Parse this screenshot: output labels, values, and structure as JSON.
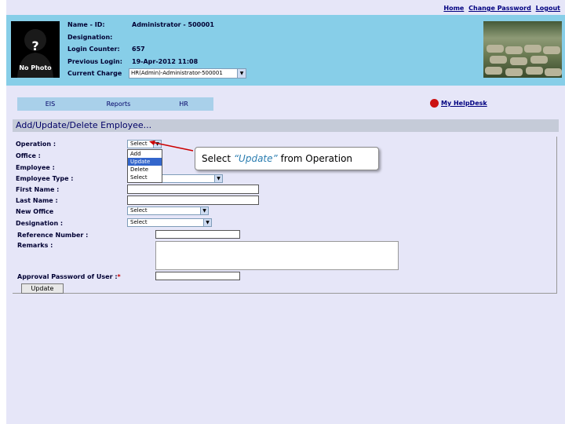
{
  "top_links": {
    "home": "Home",
    "change_password": "Change Password",
    "logout": "Logout"
  },
  "profile": {
    "photo_caption": "No Photo",
    "photo_mark": "?",
    "name_label": "Name - ID:",
    "name_value": "Administrator - 500001",
    "designation_label": "Designation:",
    "designation_value": "",
    "login_counter_label": "Login Counter:",
    "login_counter_value": "657",
    "previous_login_label": "Previous Login:",
    "previous_login_value": "19-Apr-2012 11:08",
    "current_charge_label": "Current Charge",
    "current_charge_value": "HR(Admin)-Administrator-500001"
  },
  "nav": {
    "tabs": [
      "EIS",
      "Reports",
      "HR"
    ]
  },
  "helpdesk": "My HelpDesk",
  "page_title": "Add/Update/Delete Employee...",
  "form": {
    "operation_label": "Operation :",
    "operation_value": "Select",
    "operation_options": [
      "Add",
      "Update",
      "Delete",
      "Select"
    ],
    "office_label": "Office :",
    "employee_label": "Employee :",
    "employee_type_label": "Employee Type :",
    "first_name_label": "First Name :",
    "last_name_label": "Last Name :",
    "new_office_label": "New Office",
    "new_office_value": "Select",
    "designation_label": "Designation :",
    "designation_value": "Select",
    "reference_number_label": "Reference Number :",
    "remarks_label": "Remarks :",
    "approval_password_label": "Approval Password of User :",
    "required_mark": "*",
    "update_button": "Update"
  },
  "callout": {
    "prefix": "Select ",
    "emphasis": "“Update”",
    "suffix": " from Operation"
  },
  "colors": {
    "header_bg": "#87cee8",
    "page_bg": "#e6e6f8",
    "title_bar": "#c5cbd8",
    "nav_bg": "#a9d0ea",
    "arrow": "#cc0000",
    "link": "#000080"
  },
  "icons": {
    "helpdesk": "red-circle-icon",
    "dropdown": "chevron-down-icon"
  }
}
